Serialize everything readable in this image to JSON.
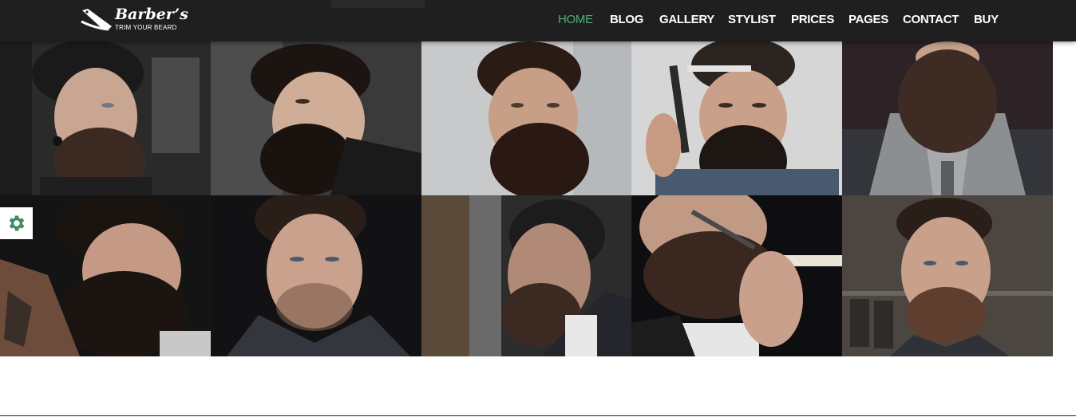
{
  "brand": {
    "title": "Barber’s",
    "tagline": "TRIM YOUR BEARD",
    "icon": "straight-razor-icon"
  },
  "nav": {
    "items": [
      {
        "label": "HOME",
        "active": true
      },
      {
        "label": "BLOG",
        "active": false
      },
      {
        "label": "GALLERY",
        "active": false
      },
      {
        "label": "STYLIST",
        "active": false
      },
      {
        "label": "PRICES",
        "active": false
      },
      {
        "label": "PAGES",
        "active": false
      },
      {
        "label": "CONTACT",
        "active": false
      },
      {
        "label": "BUY",
        "active": false
      }
    ],
    "active_color": "#4caf7a"
  },
  "gallery": {
    "rows": 2,
    "columns": 5,
    "photos": [
      "bearded-man-beanie-photo",
      "bearded-man-profile-photo",
      "bearded-man-light-wall-photo",
      "man-holding-straight-razor-photo",
      "beard-striped-shirt-photo",
      "tattooed-bearded-man-photo",
      "stubble-man-coat-photo",
      "bearded-man-window-photo",
      "man-shaving-razor-photo",
      "mustache-man-barbershop-photo"
    ]
  },
  "settings": {
    "icon": "gear-icon",
    "color": "#3d8b5f"
  }
}
